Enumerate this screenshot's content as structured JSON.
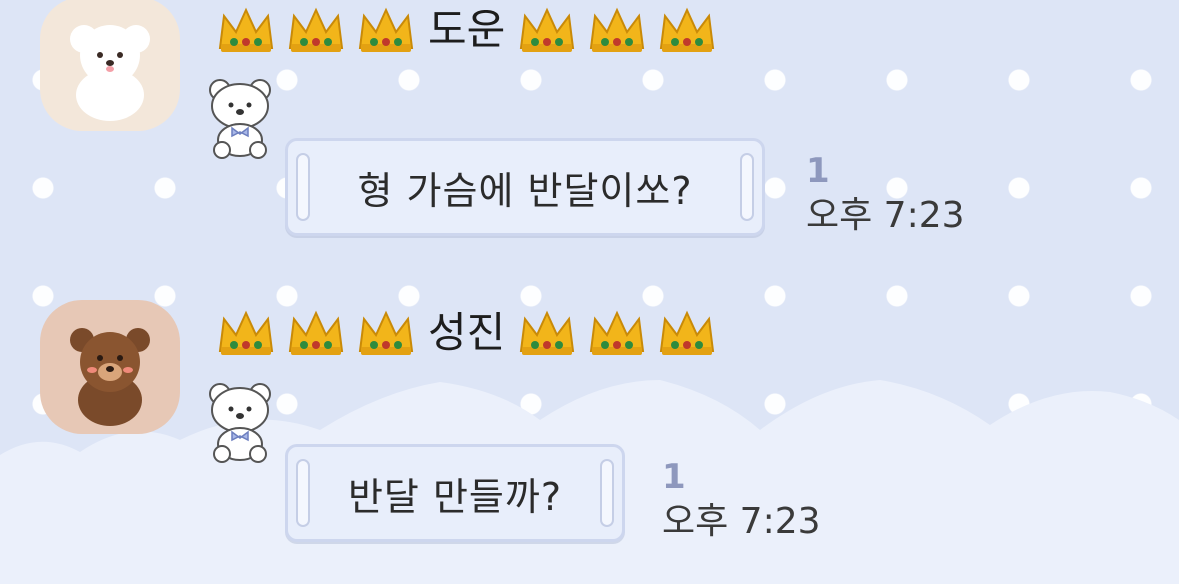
{
  "messages": [
    {
      "sender": "도운",
      "avatar_icon": "white-puppy-icon",
      "text": "형 가슴에 반달이쏘?",
      "unread": "1",
      "time": "오후 7:23"
    },
    {
      "sender": "성진",
      "avatar_icon": "brown-bear-icon",
      "text": "반달 만들까?",
      "unread": "1",
      "time": "오후 7:23"
    }
  ],
  "colors": {
    "background": "#dde5f6",
    "bubble": "#e8eefb",
    "bubble_border": "#cdd6ee",
    "unread": "#8e98bd",
    "crown_gold": "#f2b51a"
  },
  "decorations": {
    "crown_icon": "crown-emoji",
    "bear_icon": "white-teddy-bear-icon"
  }
}
